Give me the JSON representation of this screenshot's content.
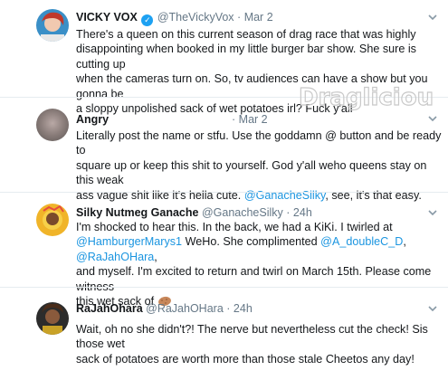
{
  "tweets": [
    {
      "name": "VICKY VOX",
      "handle": "@TheVickyVox",
      "separator": "·",
      "time": "Mar 2",
      "verified": true,
      "lines": [
        [
          "There's a queen on this current season of drag race that was highly"
        ],
        [
          "disappointing when booked in my little burger bar show. She sure is cutting up"
        ],
        [
          "when the cameras turn on. So, tv audiences can have a show but you gonna be"
        ],
        [
          "a sloppy unpolished sack of wet potatoes irl? Fuck y'all"
        ]
      ]
    },
    {
      "name": "Angry",
      "handle": "",
      "separator": "·",
      "time": "Mar 2",
      "lines": [
        "Literally post the name or stfu. Use the goddamn @ button and be ready to",
        "square up or keep this shit to yourself. God y'all weho queens stay on this weak",
        "ass vague shit like it's hella cute.",
        "@GanacheSilky",
        ", see, it's that easy."
      ]
    },
    {
      "name": "Silky Nutmeg Ganache",
      "handle": "@GanacheSilky",
      "separator": "·",
      "time": "24h",
      "lines": [
        "I'm shocked to hear this. In the back, we had a KiKi. I twirled at",
        "@HamburgerMarys1",
        "WeHo. She complimented",
        "@A_doubleC_D",
        ",",
        "@RaJahOHara",
        ",",
        "and myself. I'm excited to return and twirl on March 15th. Please come witness",
        "this wet sack of"
      ],
      "emoji": "potato-emoji"
    },
    {
      "name": "RaJahOhara",
      "handle": "@RaJahOHara",
      "separator": "·",
      "time": "24h",
      "lines": [
        "Wait, oh no she didn't?! The nerve but nevertheless cut the check! Sis those wet",
        "sack of potatoes are worth more than those stale Cheetos any day!"
      ]
    }
  ],
  "watermark": {
    "text": "Draglicious"
  },
  "colors": {
    "link": "#1b95e0",
    "muted": "#657786",
    "verified": "#1da1f2",
    "divider": "#e6ecf0"
  }
}
